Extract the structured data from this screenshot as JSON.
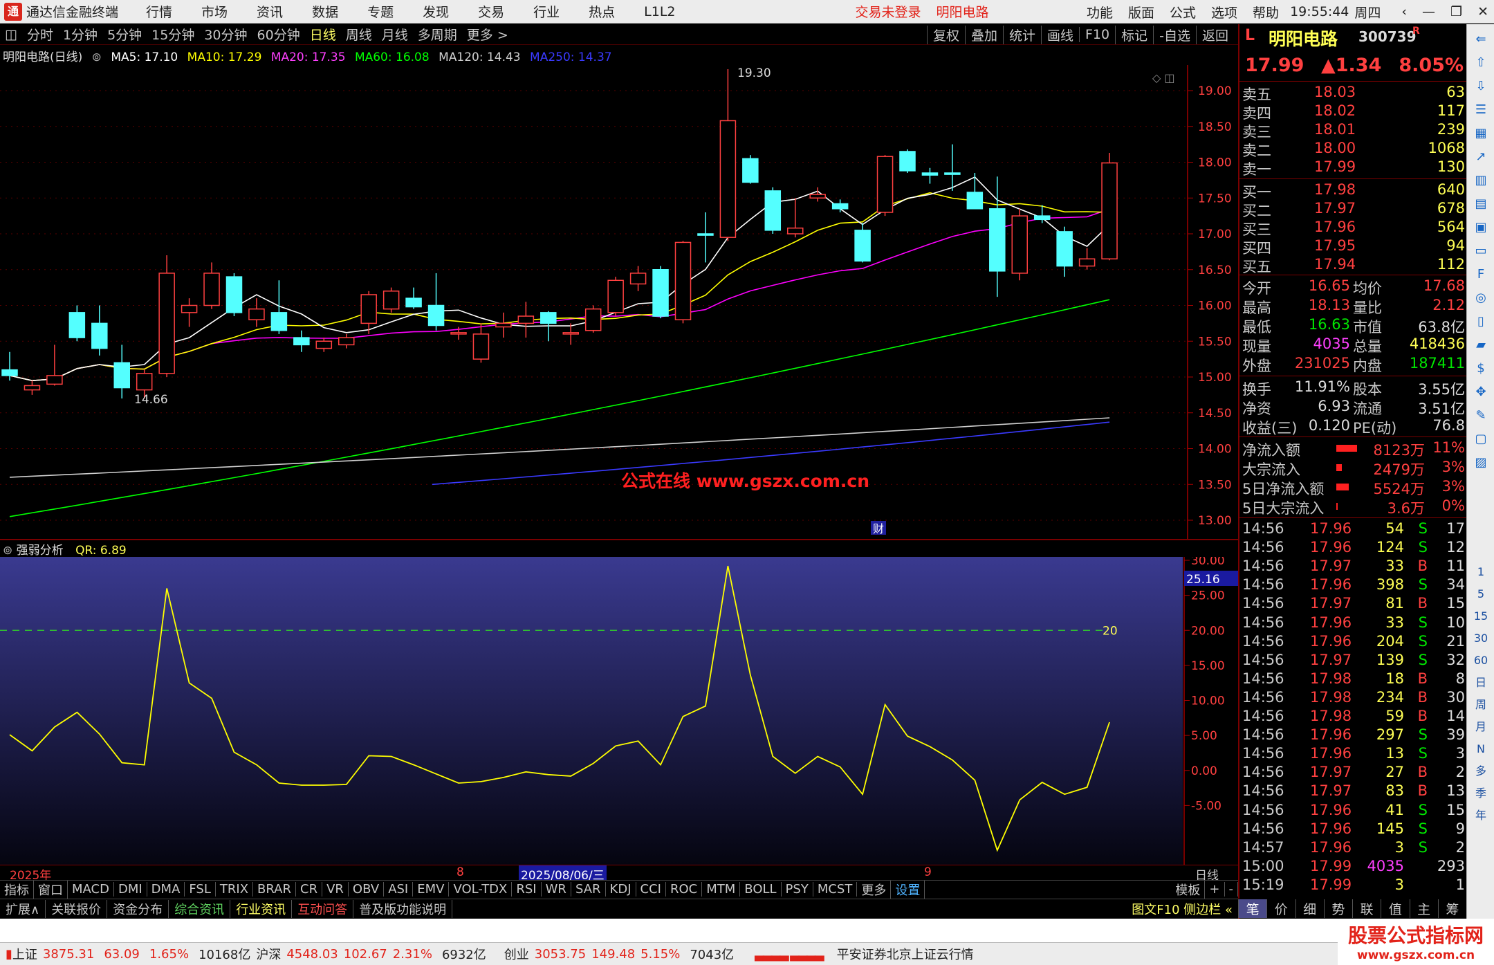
{
  "titlebar": {
    "app": "通达信金融终端",
    "menus": [
      "行情",
      "市场",
      "资讯",
      "数据",
      "专题",
      "发现",
      "交易",
      "行业",
      "热点",
      "L1L2"
    ],
    "login": "交易未登录",
    "stock": "明阳电路",
    "right_menus": [
      "功能",
      "版面",
      "公式",
      "选项",
      "帮助"
    ],
    "time": "19:55:44",
    "weekday": "周四"
  },
  "periodbar": {
    "items": [
      "分时",
      "1分钟",
      "5分钟",
      "15分钟",
      "30分钟",
      "60分钟",
      "日线",
      "周线",
      "月线",
      "多周期",
      "更多 >"
    ],
    "active": "日线",
    "right": [
      "复权",
      "叠加",
      "统计",
      "画线",
      "F10",
      "标记",
      "-自选",
      "返回"
    ]
  },
  "ma_legend": {
    "name": "明阳电路(日线)",
    "ma5": "MA5: 17.10",
    "ma10": "MA10: 17.29",
    "ma20": "MA20: 17.35",
    "ma60": "MA60: 16.08",
    "ma120": "MA120: 14.43",
    "ma250": "MA250: 14.37",
    "colors": {
      "ma5": "#ffffff",
      "ma10": "#ffff00",
      "ma20": "#ff00ff",
      "ma60": "#00ff00",
      "ma120": "#d0d0d0",
      "ma250": "#3a3aff"
    }
  },
  "price_chart": {
    "high_label": "19.30",
    "low_label": "14.66",
    "watermark": "公式在线  www.gszx.com.cn",
    "fin_marker": "财",
    "y_ticks": [
      "19.00",
      "18.50",
      "18.00",
      "17.50",
      "17.00",
      "16.50",
      "16.00",
      "15.50",
      "15.00",
      "14.50",
      "14.00",
      "13.50",
      "13.00"
    ]
  },
  "chart_data": [
    {
      "type": "candlestick",
      "title": "明阳电路(日线)",
      "ylim": [
        13.0,
        19.0
      ],
      "candles": [
        {
          "o": 15.1,
          "h": 15.35,
          "l": 14.95,
          "c": 15.02
        },
        {
          "o": 14.82,
          "h": 14.95,
          "l": 14.75,
          "c": 14.88
        },
        {
          "o": 14.9,
          "h": 15.45,
          "l": 14.88,
          "c": 15.02
        },
        {
          "o": 15.9,
          "h": 16.0,
          "l": 15.5,
          "c": 15.55
        },
        {
          "o": 15.75,
          "h": 16.0,
          "l": 15.3,
          "c": 15.4
        },
        {
          "o": 15.2,
          "h": 15.45,
          "l": 14.7,
          "c": 14.85
        },
        {
          "o": 14.82,
          "h": 15.1,
          "l": 14.7,
          "c": 15.05
        },
        {
          "o": 15.05,
          "h": 16.7,
          "l": 15.0,
          "c": 16.45
        },
        {
          "o": 15.9,
          "h": 16.1,
          "l": 15.7,
          "c": 16.0
        },
        {
          "o": 16.0,
          "h": 16.6,
          "l": 15.95,
          "c": 16.45
        },
        {
          "o": 16.4,
          "h": 16.45,
          "l": 15.85,
          "c": 15.9
        },
        {
          "o": 15.8,
          "h": 16.1,
          "l": 15.7,
          "c": 15.95
        },
        {
          "o": 15.9,
          "h": 16.35,
          "l": 15.6,
          "c": 15.65
        },
        {
          "o": 15.55,
          "h": 15.65,
          "l": 15.35,
          "c": 15.45
        },
        {
          "o": 15.4,
          "h": 15.55,
          "l": 15.35,
          "c": 15.5
        },
        {
          "o": 15.45,
          "h": 15.6,
          "l": 15.4,
          "c": 15.55
        },
        {
          "o": 15.75,
          "h": 16.2,
          "l": 15.6,
          "c": 16.15
        },
        {
          "o": 15.95,
          "h": 16.25,
          "l": 15.9,
          "c": 16.2
        },
        {
          "o": 16.1,
          "h": 16.25,
          "l": 15.95,
          "c": 15.98
        },
        {
          "o": 16.0,
          "h": 16.45,
          "l": 15.65,
          "c": 15.72
        },
        {
          "o": 15.6,
          "h": 15.7,
          "l": 15.52,
          "c": 15.62
        },
        {
          "o": 15.25,
          "h": 15.75,
          "l": 15.2,
          "c": 15.6
        },
        {
          "o": 15.7,
          "h": 15.9,
          "l": 15.55,
          "c": 15.75
        },
        {
          "o": 15.75,
          "h": 16.05,
          "l": 15.55,
          "c": 15.85
        },
        {
          "o": 15.9,
          "h": 15.92,
          "l": 15.5,
          "c": 15.75
        },
        {
          "o": 15.6,
          "h": 15.75,
          "l": 15.45,
          "c": 15.62
        },
        {
          "o": 15.65,
          "h": 16.0,
          "l": 15.62,
          "c": 15.95
        },
        {
          "o": 15.9,
          "h": 16.4,
          "l": 15.85,
          "c": 16.35
        },
        {
          "o": 16.3,
          "h": 16.55,
          "l": 16.2,
          "c": 16.45
        },
        {
          "o": 16.5,
          "h": 16.55,
          "l": 15.82,
          "c": 15.85
        },
        {
          "o": 15.8,
          "h": 16.9,
          "l": 15.75,
          "c": 16.88
        },
        {
          "o": 17.0,
          "h": 17.3,
          "l": 16.6,
          "c": 16.98
        },
        {
          "o": 16.95,
          "h": 19.3,
          "l": 16.9,
          "c": 18.58
        },
        {
          "o": 18.05,
          "h": 18.1,
          "l": 17.7,
          "c": 17.72
        },
        {
          "o": 17.6,
          "h": 17.65,
          "l": 17.0,
          "c": 17.05
        },
        {
          "o": 17.0,
          "h": 17.5,
          "l": 16.95,
          "c": 17.08
        },
        {
          "o": 17.5,
          "h": 17.65,
          "l": 17.45,
          "c": 17.55
        },
        {
          "o": 17.42,
          "h": 17.48,
          "l": 17.3,
          "c": 17.35
        },
        {
          "o": 17.05,
          "h": 17.15,
          "l": 16.6,
          "c": 16.62
        },
        {
          "o": 17.3,
          "h": 18.1,
          "l": 17.25,
          "c": 18.08
        },
        {
          "o": 18.15,
          "h": 18.18,
          "l": 17.85,
          "c": 17.88
        },
        {
          "o": 17.85,
          "h": 17.92,
          "l": 17.7,
          "c": 17.82
        },
        {
          "o": 17.85,
          "h": 18.25,
          "l": 17.6,
          "c": 17.83
        },
        {
          "o": 17.58,
          "h": 17.85,
          "l": 17.5,
          "c": 17.35
        },
        {
          "o": 17.35,
          "h": 17.8,
          "l": 16.12,
          "c": 16.48
        },
        {
          "o": 16.45,
          "h": 17.35,
          "l": 16.35,
          "c": 17.25
        },
        {
          "o": 17.25,
          "h": 17.4,
          "l": 17.15,
          "c": 17.2
        },
        {
          "o": 17.03,
          "h": 17.1,
          "l": 16.4,
          "c": 16.55
        },
        {
          "o": 16.55,
          "h": 16.8,
          "l": 16.5,
          "c": 16.65
        },
        {
          "o": 16.65,
          "h": 18.13,
          "l": 16.63,
          "c": 17.99
        }
      ],
      "ma5_label": "MA5",
      "ma10_label": "MA10",
      "ma20_label": "MA20",
      "ma60": {
        "start": 13.05,
        "end": 16.08
      },
      "ma120": {
        "start": 13.6,
        "end": 14.43
      },
      "ma250": {
        "start": 13.6,
        "end": 14.37
      }
    },
    {
      "type": "line",
      "title": "强弱分析",
      "legend": "QR: 6.89",
      "ylim": [
        -10,
        30
      ],
      "reference_line": 20,
      "reference_label": "20",
      "current_value_label": "25.16",
      "y_ticks": [
        "30.00",
        "25.00",
        "20.00",
        "15.00",
        "10.00",
        "5.00",
        "0.00",
        "-5.00"
      ],
      "values": [
        5.1,
        2.8,
        6.2,
        8.3,
        5.2,
        1.1,
        0.8,
        26.0,
        12.5,
        10.3,
        2.6,
        0.8,
        -1.8,
        -2.1,
        -2.1,
        -2.0,
        2.1,
        2.0,
        0.8,
        -0.5,
        -1.8,
        -1.6,
        -1.0,
        -0.2,
        -0.6,
        -0.8,
        1.0,
        3.5,
        4.2,
        0.8,
        7.7,
        9.2,
        29.2,
        13.6,
        2.0,
        -0.4,
        2.0,
        0.5,
        -3.4,
        9.4,
        4.9,
        3.4,
        1.5,
        -1.4,
        -11.4,
        -4.2,
        -1.7,
        -3.4,
        -2.4,
        6.89
      ]
    }
  ],
  "indicator_panel": {
    "title": "强弱分析",
    "value": "QR: 6.89"
  },
  "xaxis": {
    "year": "2025年",
    "m8": "8",
    "date": "2025/08/06/三",
    "m9": "9",
    "period": "日线"
  },
  "indtabs": [
    "指标",
    "窗口",
    "MACD",
    "DMI",
    "DMA",
    "FSL",
    "TRIX",
    "BRAR",
    "CR",
    "VR",
    "OBV",
    "ASI",
    "EMV",
    "VOL-TDX",
    "RSI",
    "WR",
    "SAR",
    "KDJ",
    "CCI",
    "ROC",
    "MTM",
    "BOLL",
    "PSY",
    "MCST",
    "更多",
    "设置"
  ],
  "indtabs_right": [
    "模板",
    "+",
    "-"
  ],
  "bottomtabs": [
    "扩展∧",
    "关联报价",
    "资金分布",
    "综合资讯",
    "行业资讯",
    "互动问答",
    "普及版功能说明"
  ],
  "bottomtabs_right": "图文F10 侧边栏 «",
  "quote": {
    "prefix": "L",
    "name": "明阳电路",
    "code": "300739",
    "flag": "R",
    "price": "17.99",
    "change": "▲1.34",
    "pct": "8.05%",
    "asks": [
      {
        "label": "卖五",
        "price": "18.03",
        "vol": "63"
      },
      {
        "label": "卖四",
        "price": "18.02",
        "vol": "117"
      },
      {
        "label": "卖三",
        "price": "18.01",
        "vol": "239"
      },
      {
        "label": "卖二",
        "price": "18.00",
        "vol": "1068"
      },
      {
        "label": "卖一",
        "price": "17.99",
        "vol": "130"
      }
    ],
    "bids": [
      {
        "label": "买一",
        "price": "17.98",
        "vol": "640"
      },
      {
        "label": "买二",
        "price": "17.97",
        "vol": "678"
      },
      {
        "label": "买三",
        "price": "17.96",
        "vol": "564"
      },
      {
        "label": "买四",
        "price": "17.95",
        "vol": "94"
      },
      {
        "label": "买五",
        "price": "17.94",
        "vol": "112"
      }
    ],
    "stats": [
      {
        "l1": "今开",
        "v1": "16.65",
        "l2": "均价",
        "v2": "17.68"
      },
      {
        "l1": "最高",
        "v1": "18.13",
        "l2": "量比",
        "v2": "2.12"
      },
      {
        "l1": "最低",
        "v1": "16.63",
        "l2": "市值",
        "v2": "63.8亿"
      },
      {
        "l1": "现量",
        "v1": "4035",
        "l2": "总量",
        "v2": "418436"
      },
      {
        "l1": "外盘",
        "v1": "231025",
        "l2": "内盘",
        "v2": "187411"
      }
    ],
    "stats2": [
      {
        "l1": "换手",
        "v1": "11.91%",
        "l2": "股本",
        "v2": "3.55亿"
      },
      {
        "l1": "净资",
        "v1": "6.93",
        "l2": "流通",
        "v2": "3.51亿"
      },
      {
        "l1": "收益(三)",
        "v1": "0.120",
        "l2": "PE(动)",
        "v2": "76.8"
      }
    ],
    "flows": [
      {
        "label": "净流入额",
        "value": "8123万",
        "pct": "11%",
        "bar": 0.75
      },
      {
        "label": "大宗流入",
        "value": "2479万",
        "pct": "3%",
        "bar": 0.2
      },
      {
        "label": "5日净流入额",
        "value": "5524万",
        "pct": "3%",
        "bar": 0.45
      },
      {
        "label": "5日大宗流入",
        "value": "3.6万",
        "pct": "0%",
        "bar": 0.02
      }
    ],
    "ticks": [
      {
        "t": "14:56",
        "p": "17.96",
        "v": "54",
        "bs": "S",
        "n": "17"
      },
      {
        "t": "14:56",
        "p": "17.96",
        "v": "124",
        "bs": "S",
        "n": "12"
      },
      {
        "t": "14:56",
        "p": "17.97",
        "v": "33",
        "bs": "B",
        "n": "11"
      },
      {
        "t": "14:56",
        "p": "17.96",
        "v": "398",
        "bs": "S",
        "n": "34"
      },
      {
        "t": "14:56",
        "p": "17.97",
        "v": "81",
        "bs": "B",
        "n": "15"
      },
      {
        "t": "14:56",
        "p": "17.96",
        "v": "33",
        "bs": "S",
        "n": "10"
      },
      {
        "t": "14:56",
        "p": "17.96",
        "v": "204",
        "bs": "S",
        "n": "21"
      },
      {
        "t": "14:56",
        "p": "17.97",
        "v": "139",
        "bs": "S",
        "n": "32"
      },
      {
        "t": "14:56",
        "p": "17.98",
        "v": "18",
        "bs": "B",
        "n": "8"
      },
      {
        "t": "14:56",
        "p": "17.98",
        "v": "234",
        "bs": "B",
        "n": "30"
      },
      {
        "t": "14:56",
        "p": "17.98",
        "v": "59",
        "bs": "B",
        "n": "14"
      },
      {
        "t": "14:56",
        "p": "17.96",
        "v": "297",
        "bs": "S",
        "n": "39"
      },
      {
        "t": "14:56",
        "p": "17.96",
        "v": "13",
        "bs": "S",
        "n": "3"
      },
      {
        "t": "14:56",
        "p": "17.97",
        "v": "27",
        "bs": "B",
        "n": "2"
      },
      {
        "t": "14:56",
        "p": "17.97",
        "v": "83",
        "bs": "B",
        "n": "13"
      },
      {
        "t": "14:56",
        "p": "17.96",
        "v": "41",
        "bs": "S",
        "n": "15"
      },
      {
        "t": "14:56",
        "p": "17.96",
        "v": "145",
        "bs": "S",
        "n": "9"
      },
      {
        "t": "14:57",
        "p": "17.96",
        "v": "3",
        "bs": "S",
        "n": "2"
      },
      {
        "t": "15:00",
        "p": "17.99",
        "v": "4035",
        "bs": "",
        "n": "293"
      },
      {
        "t": "15:19",
        "p": "17.99",
        "v": "3",
        "bs": "",
        "n": "1"
      }
    ]
  },
  "quotetabs": [
    "笔",
    "价",
    "细",
    "势",
    "联",
    "值",
    "主",
    "筹"
  ],
  "sidebar_labels": [
    "1",
    "5",
    "15",
    "30",
    "60",
    "日",
    "周",
    "月",
    "N",
    "多",
    "季",
    "年"
  ],
  "statusbar": {
    "sh_label": "上证",
    "sh_val": "3875.31",
    "sh_chg": "63.09",
    "sh_pct": "1.65%",
    "sh_amt": "10168亿",
    "sz_label": "沪深",
    "sz_val": "4548.03",
    "sz_chg": "102.67",
    "sz_pct": "2.31%",
    "sz_amt": "6932亿",
    "cy_label": "创业",
    "cy_val": "3053.75",
    "cy_chg": "149.48",
    "cy_pct": "5.15%",
    "cy_amt": "7043亿",
    "server": "平安证券北京上证云行情",
    "brand": "股票公式指标网",
    "brand_url": "www.gszx.com.cn"
  }
}
